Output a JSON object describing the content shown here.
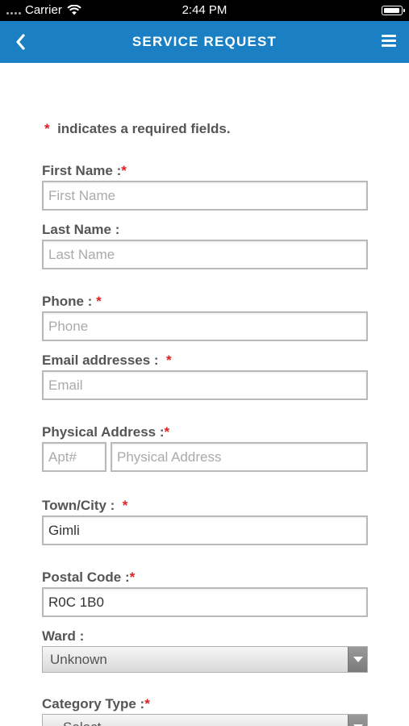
{
  "status_bar": {
    "carrier": "Carrier",
    "time": "2:44 PM"
  },
  "nav": {
    "title": "SERVICE REQUEST"
  },
  "required_note": {
    "star": "*",
    "text": "indicates a required fields."
  },
  "form": {
    "first_name": {
      "label": "First Name :",
      "required": "*",
      "placeholder": "First Name",
      "value": ""
    },
    "last_name": {
      "label": "Last Name :",
      "placeholder": "Last Name",
      "value": ""
    },
    "phone": {
      "label": "Phone :",
      "required": "*",
      "placeholder": "Phone",
      "value": ""
    },
    "email": {
      "label": "Email addresses :",
      "required": "*",
      "placeholder": "Email",
      "value": ""
    },
    "address": {
      "label": "Physical Address :",
      "required": "*",
      "apt_placeholder": "Apt#",
      "placeholder": "Physical Address",
      "value": ""
    },
    "town": {
      "label": "Town/City :",
      "required": "*",
      "value": "Gimli"
    },
    "postal": {
      "label": "Postal Code :",
      "required": "*",
      "value": "R0C 1B0"
    },
    "ward": {
      "label": "Ward :",
      "selected": "Unknown"
    },
    "category": {
      "label": "Category Type :",
      "required": "*",
      "selected": "-- Select --"
    }
  }
}
